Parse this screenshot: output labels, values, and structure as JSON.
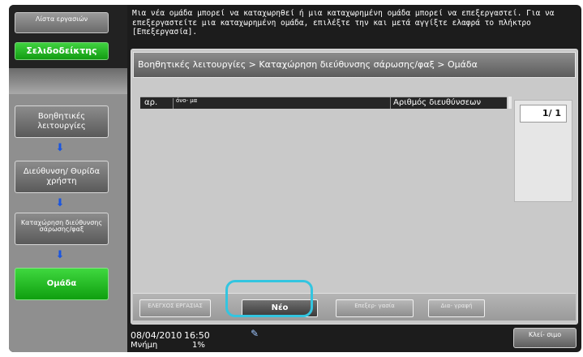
{
  "left": {
    "jobs_label": "Λίστα εργασιών",
    "bookmark_label": "Σελιδοδείκτης",
    "nav": [
      {
        "label": "Βοηθητικές λειτουργίες"
      },
      {
        "label": "Διεύθυνση/ Θυρίδα χρήστη"
      },
      {
        "label": "Καταχώρηση διεύθυνσης σάρωσης/φαξ"
      },
      {
        "label": "Ομάδα"
      }
    ],
    "arrow_icon": "arrow-down-icon"
  },
  "message": "Μια νέα ομάδα μπορεί να καταχωρηθεί ή μια καταχωρημένη ομάδα μπορεί να επεξεργαστεί. Για να επεξεργαστείτε μια καταχωρημένη ομάδα, επιλέξτε την και μετά αγγίξτε ελαφρά το πλήκτρο [Επεξεργασία].",
  "breadcrumb": "Βοηθητικές λειτουργίες > Καταχώρηση διεύθυνσης σάρωσης/φαξ > Ομάδα",
  "table": {
    "columns": {
      "no": "αρ.",
      "name": "όνο- μα",
      "addresses": "Αριθμός διευθύνσεων"
    },
    "rows": []
  },
  "pager": {
    "page": "1/ 1"
  },
  "buttons": {
    "job_check": "ΕΛΕΓΧΟΣ ΕΡΓΑΣΙΑΣ",
    "new": "Νέο",
    "edit": "Επεξερ- γασία",
    "delete": "Δια- γραφή"
  },
  "status": {
    "date": "08/04/2010",
    "time": "16:50",
    "memory_label": "Μνήμη",
    "memory_value": "1%",
    "network_icon": "network-icon",
    "close_label": "Κλεί- σιμο"
  },
  "colors": {
    "accent_green": "#1faa1f",
    "highlight": "#33c5e0",
    "arrow": "#1a55e0"
  }
}
